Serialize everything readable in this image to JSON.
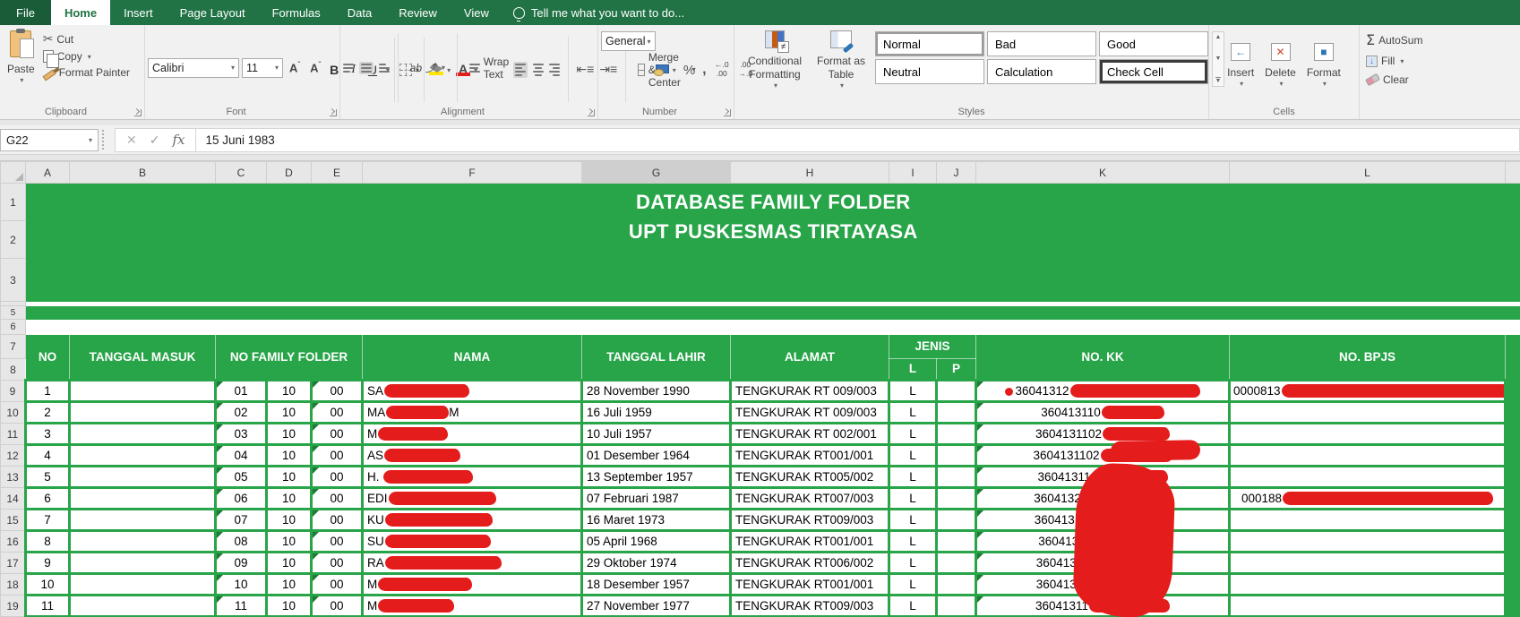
{
  "ribbon": {
    "tabs": [
      {
        "label": "File",
        "active": false
      },
      {
        "label": "Home",
        "active": true
      },
      {
        "label": "Insert",
        "active": false
      },
      {
        "label": "Page Layout",
        "active": false
      },
      {
        "label": "Formulas",
        "active": false
      },
      {
        "label": "Data",
        "active": false
      },
      {
        "label": "Review",
        "active": false
      },
      {
        "label": "View",
        "active": false
      }
    ],
    "tell_me": "Tell me what you want to do...",
    "clipboard": {
      "label": "Clipboard",
      "paste": "Paste",
      "cut": "Cut",
      "copy": "Copy",
      "format_painter": "Format Painter"
    },
    "font": {
      "label": "Font",
      "family": "Calibri",
      "size": "11",
      "bold": "B",
      "italic": "I",
      "underline": "U"
    },
    "alignment": {
      "label": "Alignment",
      "wrap_text": "Wrap Text",
      "merge_center": "Merge & Center",
      "orientation": "ab"
    },
    "number": {
      "label": "Number",
      "format": "General",
      "percent": "%",
      "comma": ",",
      "inc_dec": "←.0 .00",
      "dec_dec": ".00 →.0"
    },
    "styles": {
      "label": "Styles",
      "conditional_formatting": "Conditional Formatting",
      "format_as_table": "Format as Table",
      "chips": [
        {
          "label": "Normal",
          "bg": "#ffffff",
          "fg": "#000000",
          "border": "#8a8a8a",
          "weight": "normal"
        },
        {
          "label": "Bad",
          "bg": "#ffc7ce",
          "fg": "#9c0006",
          "border": "#ffc7ce",
          "weight": "normal"
        },
        {
          "label": "Good",
          "bg": "#c6efce",
          "fg": "#006100",
          "border": "#c6efce",
          "weight": "normal"
        },
        {
          "label": "Neutral",
          "bg": "#ffeb9c",
          "fg": "#9c6500",
          "border": "#ffeb9c",
          "weight": "normal"
        },
        {
          "label": "Calculation",
          "bg": "#f2f2f2",
          "fg": "#fa7d00",
          "border": "#7f7f7f",
          "weight": "bold"
        },
        {
          "label": "Check Cell",
          "bg": "#a5a5a5",
          "fg": "#ffffff",
          "border": "#3c3c3c",
          "weight": "bold"
        }
      ]
    },
    "cells": {
      "label": "Cells",
      "insert": "Insert",
      "delete": "Delete",
      "format": "Format"
    },
    "editing": {
      "autosum": "AutoSum",
      "fill": "Fill",
      "clear": "Clear"
    }
  },
  "formula_bar": {
    "name_box": "G22",
    "value": "15 Juni 1983"
  },
  "grid": {
    "columns": [
      "A",
      "B",
      "C",
      "D",
      "E",
      "F",
      "G",
      "H",
      "I",
      "J",
      "K",
      "L"
    ],
    "selected_column": "G",
    "gutter": {
      "r1": "1",
      "r2": "2",
      "r3": "3",
      "r4": "",
      "r5": "5",
      "r6": "6",
      "r7": "7",
      "r8": "8"
    },
    "title_line1": "DATABASE FAMILY FOLDER",
    "title_line2": "UPT PUSKESMAS TIRTAYASA",
    "header": {
      "no": "NO",
      "tanggal_masuk": "TANGGAL MASUK",
      "no_family_folder": "NO FAMILY FOLDER",
      "nama": "NAMA",
      "tanggal_lahir": "TANGGAL LAHIR",
      "alamat": "ALAMAT",
      "jenis": "JENIS",
      "l": "L",
      "p": "P",
      "no_kk": "NO. KK",
      "no_bpjs": "NO. BPJS"
    },
    "rows": [
      {
        "n": "9",
        "no": "1",
        "masuk": "",
        "c": "01",
        "d": "10",
        "e": "00",
        "nama": "SA",
        "nama_blob": 95,
        "nama_suffix": "",
        "lahir": "28 November 1990",
        "alamat": "TENGKURAK RT 009/003",
        "l": "L",
        "p": "",
        "kk": "36041312",
        "kk_dot": true,
        "kk_blob": 145,
        "bpjs": "0000813",
        "bpjs_blob": 255
      },
      {
        "n": "10",
        "no": "2",
        "masuk": "",
        "c": "02",
        "d": "10",
        "e": "00",
        "nama": "MA",
        "nama_blob": 70,
        "nama_suffix": "M",
        "lahir": "16 Juli 1959",
        "alamat": "TENGKURAK RT 009/003",
        "l": "L",
        "p": "",
        "kk": "360413110",
        "kk_dot": false,
        "kk_blob": 70,
        "bpjs": "",
        "bpjs_blob": 0
      },
      {
        "n": "11",
        "no": "3",
        "masuk": "",
        "c": "03",
        "d": "10",
        "e": "00",
        "nama": "M",
        "nama_blob": 78,
        "nama_suffix": "",
        "lahir": "10 Juli 1957",
        "alamat": "TENGKURAK RT 002/001",
        "l": "L",
        "p": "",
        "kk": "3604131102",
        "kk_dot": false,
        "kk_blob": 75,
        "bpjs": "",
        "bpjs_blob": 0
      },
      {
        "n": "12",
        "no": "4",
        "masuk": "",
        "c": "04",
        "d": "10",
        "e": "00",
        "nama": "AS",
        "nama_blob": 85,
        "nama_suffix": "",
        "lahir": "01 Desember 1964",
        "alamat": "TENGKURAK RT001/001",
        "l": "L",
        "p": "",
        "kk": "3604131102",
        "kk_dot": false,
        "kk_blob": 80,
        "bpjs": "",
        "bpjs_blob": 0
      },
      {
        "n": "13",
        "no": "5",
        "masuk": "",
        "c": "05",
        "d": "10",
        "e": "00",
        "nama": "H. ",
        "nama_blob": 100,
        "nama_suffix": "",
        "lahir": "13 September 1957",
        "alamat": "TENGKURAK RT005/002",
        "l": "L",
        "p": "",
        "kk": "36041311",
        "kk_dot": false,
        "kk_blob": 85,
        "bpjs": "",
        "bpjs_blob": 0
      },
      {
        "n": "14",
        "no": "6",
        "masuk": "",
        "c": "06",
        "d": "10",
        "e": "00",
        "nama": "EDI",
        "nama_blob": 120,
        "nama_suffix": "",
        "lahir": "07 Februari 1987",
        "alamat": "TENGKURAK RT007/003",
        "l": "L",
        "p": "",
        "kk": "360413271",
        "kk_dot": false,
        "kk_blob": 85,
        "bpjs": "000188",
        "bpjs_blob": 235
      },
      {
        "n": "15",
        "no": "7",
        "masuk": "",
        "c": "07",
        "d": "10",
        "e": "00",
        "nama": "KU",
        "nama_blob": 120,
        "nama_suffix": "",
        "lahir": "16 Maret 1973",
        "alamat": "TENGKURAK RT009/003",
        "l": "L",
        "p": "",
        "kk": "360413110",
        "kk_dot": false,
        "kk_blob": 85,
        "bpjs": "",
        "bpjs_blob": 0
      },
      {
        "n": "16",
        "no": "8",
        "masuk": "",
        "c": "08",
        "d": "10",
        "e": "00",
        "nama": "SU",
        "nama_blob": 118,
        "nama_suffix": "",
        "lahir": "05 April 1968",
        "alamat": "TENGKURAK RT001/001",
        "l": "L",
        "p": "",
        "kk": "3604131",
        "kk_dot": false,
        "kk_blob": 90,
        "bpjs": "",
        "bpjs_blob": 0
      },
      {
        "n": "17",
        "no": "9",
        "masuk": "",
        "c": "09",
        "d": "10",
        "e": "00",
        "nama": "RA",
        "nama_blob": 130,
        "nama_suffix": "",
        "lahir": "29 Oktober 1974",
        "alamat": "TENGKURAK RT006/002",
        "l": "L",
        "p": "",
        "kk": "3604131",
        "kk_dot": false,
        "kk_blob": 95,
        "bpjs": "",
        "bpjs_blob": 0
      },
      {
        "n": "18",
        "no": "10",
        "masuk": "",
        "c": "10",
        "d": "10",
        "e": "00",
        "nama": "M",
        "nama_blob": 105,
        "nama_suffix": "",
        "lahir": "18 Desember 1957",
        "alamat": "TENGKURAK RT001/001",
        "l": "L",
        "p": "",
        "kk": "3604131",
        "kk_dot": false,
        "kk_blob": 95,
        "bpjs": "",
        "bpjs_blob": 0
      },
      {
        "n": "19",
        "no": "11",
        "masuk": "",
        "c": "11",
        "d": "10",
        "e": "00",
        "nama": "M",
        "nama_blob": 85,
        "nama_suffix": "",
        "lahir": "27 November 1977",
        "alamat": "TENGKURAK RT009/003",
        "l": "L",
        "p": "",
        "kk": "36041311",
        "kk_dot": false,
        "kk_blob": 90,
        "bpjs": "",
        "bpjs_blob": 0
      }
    ]
  },
  "colors": {
    "ribbon_green": "#217346",
    "table_green": "#28a449",
    "redaction": "#e51c1c"
  }
}
